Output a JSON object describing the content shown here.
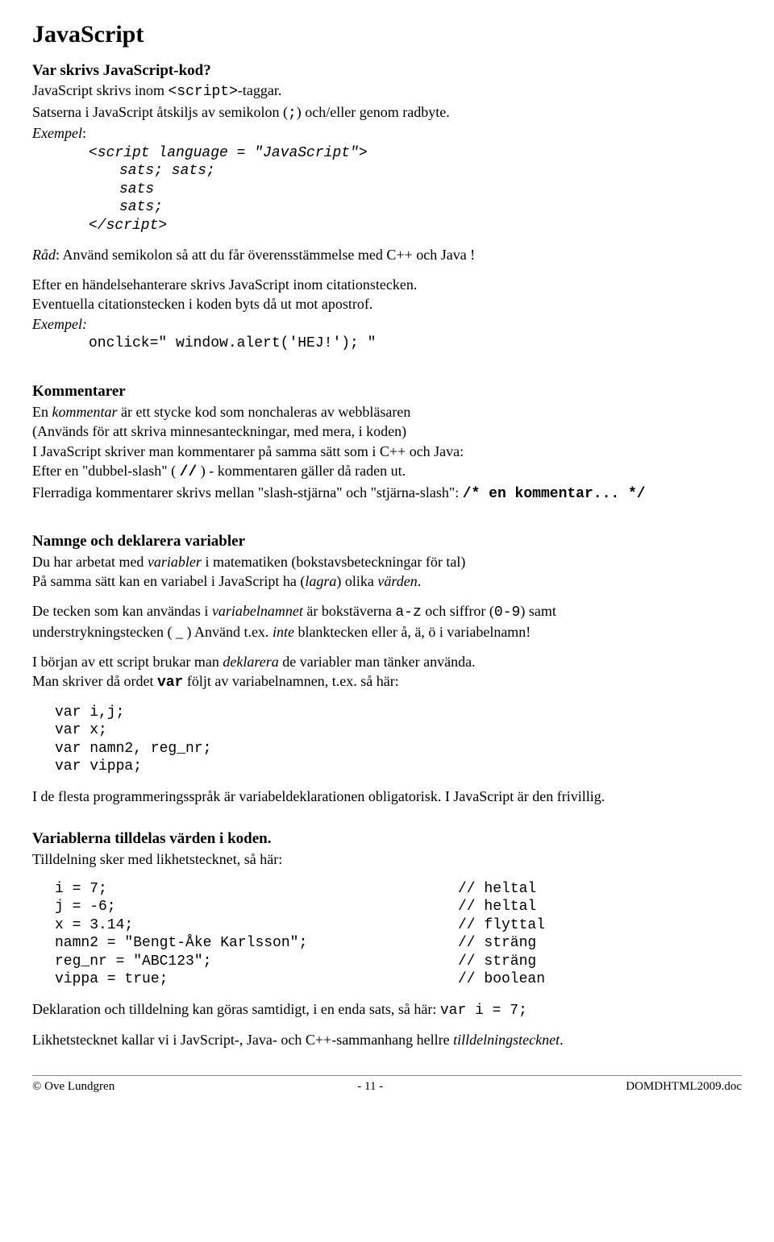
{
  "title": "JavaScript",
  "sec1": {
    "heading": "Var skrivs JavaScript-kod?",
    "p1a": "JavaScript skrivs inom ",
    "p1b": "<script>",
    "p1c": "-taggar.",
    "p2a": "Satserna i JavaScript åtskiljs av semikolon (",
    "p2b": ";",
    "p2c": ") och/eller genom radbyte.",
    "ex_label": "Exempel",
    "colon": ":",
    "code1": "<script language = \"JavaScript\">",
    "code2": "sats; sats;",
    "code3": "sats",
    "code4": "sats;",
    "code5": "</script>",
    "rad_label": "Råd",
    "rad_text": ": Använd semikolon så att du får överensstämmelse med C++ och Java !",
    "p3": "Efter en händelsehanterare skrivs JavaScript inom citationstecken.",
    "p4": "Eventuella citationstecken i koden byts då ut mot apostrof.",
    "ex2_label": "Exempel:",
    "code6": "onclick=\" window.alert('HEJ!'); \""
  },
  "sec2": {
    "heading": "Kommentarer",
    "l1a": "En ",
    "l1b": "kommentar",
    "l1c": " är ett stycke kod som nonchaleras av webbläsaren",
    "l2": "(Används för att skriva minnesanteckningar, med mera, i koden)",
    "l3": "I JavaScript skriver man kommentarer på samma sätt som i C++ och Java:",
    "l4a": "Efter en  \"dubbel-slash\" ( ",
    "l4b": "//",
    "l4c": " )   -   kommentaren gäller då raden ut.",
    "l5a": "Flerradiga kommentarer skrivs mellan \"slash-stjärna\" och \"stjärna-slash\":   ",
    "l5b": "/* en kommentar... */"
  },
  "sec3": {
    "heading": "Namnge och deklarera variabler",
    "l1a": "Du har arbetat med ",
    "l1b": "variabler",
    "l1c": " i matematiken (bokstavsbeteckningar för tal)",
    "l2a": "På samma sätt kan en  variabel i JavaScript ha (",
    "l2b": "lagra",
    "l2c": ") olika ",
    "l2d": "värden",
    "l2e": ".",
    "l3a": "De tecken som kan användas i ",
    "l3b": "variabelnamnet",
    "l3c": " är bokstäverna ",
    "l3d": "a-z",
    "l3e": " och siffror (",
    "l3f": "0-9",
    "l3g": ") samt",
    "l4a": "understrykningstecken ( _ )    Använd t.ex. ",
    "l4b": "inte",
    "l4c": " blanktecken eller å, ä, ö  i variabelnamn!",
    "l5a": "I början av ett script brukar man ",
    "l5b": "deklarera",
    "l5c": " de variabler man tänker använda.",
    "l6a": "Man skriver då ordet ",
    "l6b": "var",
    "l6c": " följt av variabelnamnen, t.ex. så här:",
    "code1": "var i,j;",
    "code2": "var x;",
    "code3": "var namn2, reg_nr;",
    "code4": "var vippa;",
    "l7": "I de flesta programmeringsspråk är variabeldeklarationen obligatorisk. I JavaScript är den frivillig."
  },
  "sec4": {
    "heading": "Variablerna tilldelas värden i koden.",
    "l1": "Tilldelning sker med likhetstecknet, så här:",
    "rows": [
      {
        "l": "i = 7;",
        "r": "// heltal"
      },
      {
        "l": "j = -6;",
        "r": "// heltal"
      },
      {
        "l": "x = 3.14;",
        "r": "// flyttal"
      },
      {
        "l": "namn2 = \"Bengt-Åke Karlsson\";",
        "r": "// sträng"
      },
      {
        "l": "reg_nr = \"ABC123\";",
        "r": "// sträng"
      },
      {
        "l": "vippa = true;",
        "r": "// boolean"
      }
    ],
    "l2a": "Deklaration och tilldelning kan göras samtidigt, i en enda sats, så här:   ",
    "l2b": "var i = 7;",
    "l3a": "Likhetstecknet kallar vi i JavScript-, Java- och C++-sammanhang  hellre ",
    "l3b": "tilldelningstecknet",
    "l3c": "."
  },
  "footer": {
    "left": "© Ove Lundgren",
    "mid": "- 11 -",
    "right": "DOMDHTML2009.doc"
  }
}
